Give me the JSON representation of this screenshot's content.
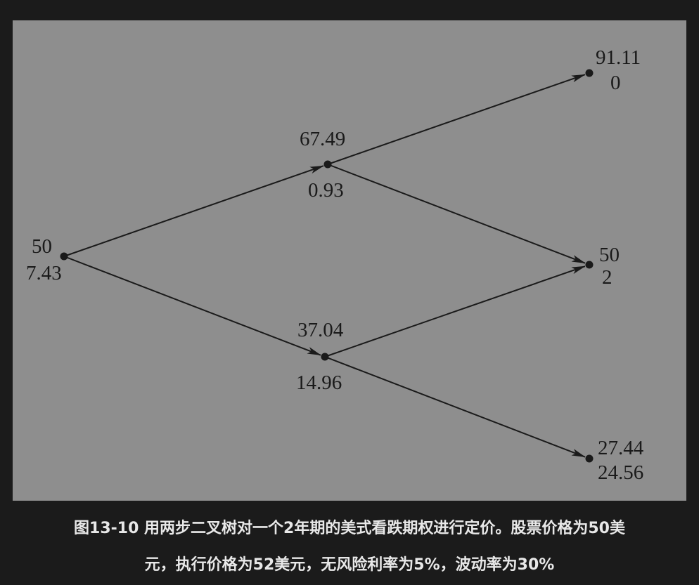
{
  "figure": {
    "caption_line1": "图13-10 用两步二叉树对一个2年期的美式看跌期权进行定价。股票价格为50美",
    "caption_line2": "元，执行价格为52美元，无风险利率为5%，波动率为30%"
  },
  "tree": {
    "nodes": [
      {
        "id": "root",
        "stock": "50",
        "option": "7.43"
      },
      {
        "id": "up",
        "stock": "67.49",
        "option": "0.93"
      },
      {
        "id": "down",
        "stock": "37.04",
        "option": "14.96"
      },
      {
        "id": "uu",
        "stock": "91.11",
        "option": "0"
      },
      {
        "id": "ud",
        "stock": "50",
        "option": "2"
      },
      {
        "id": "dd",
        "stock": "27.44",
        "option": "24.56"
      }
    ],
    "edges": [
      {
        "from": "root",
        "to": "up"
      },
      {
        "from": "root",
        "to": "down"
      },
      {
        "from": "up",
        "to": "uu"
      },
      {
        "from": "up",
        "to": "ud"
      },
      {
        "from": "down",
        "to": "ud"
      },
      {
        "from": "down",
        "to": "dd"
      }
    ]
  },
  "colors": {
    "panel_background": "#8e8e8e",
    "ink": "#1a1a1a",
    "page_background": "#1b1b1b",
    "caption_text": "#e8e8e8"
  }
}
